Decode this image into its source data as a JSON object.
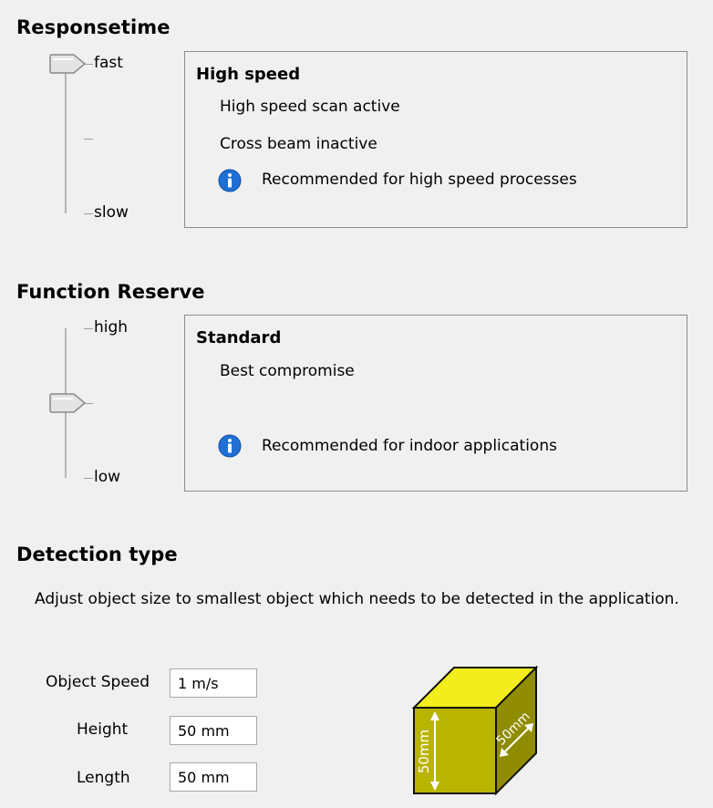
{
  "response_time": {
    "heading": "Responsetime",
    "slider": {
      "labels": [
        "fast",
        "slow"
      ],
      "level": "fast"
    },
    "panel": {
      "title": "High speed",
      "lines": [
        "High speed scan active",
        "Cross beam inactive"
      ],
      "info": "Recommended for high speed processes"
    }
  },
  "function_reserve": {
    "heading": "Function Reserve",
    "slider": {
      "labels": [
        "high",
        "low"
      ],
      "level": "middle"
    },
    "panel": {
      "title": "Standard",
      "lines": [
        "Best compromise"
      ],
      "info": "Recommended for indoor applications"
    }
  },
  "detection_type": {
    "heading": "Detection type",
    "description": "Adjust object size to smallest object which needs to be detected in the application.",
    "fields": {
      "speed": {
        "label": "Object Speed",
        "value": "1 m/s"
      },
      "height": {
        "label": "Height",
        "value": "50 mm"
      },
      "length": {
        "label": "Length",
        "value": "50 mm"
      }
    },
    "cube": {
      "height_label": "50mm",
      "depth_label": "50mm"
    }
  },
  "colors": {
    "cube_front": "#b8b400",
    "cube_top": "#f3ee1b",
    "cube_side": "#8f8c00",
    "info_icon": "#1f6fd6"
  }
}
